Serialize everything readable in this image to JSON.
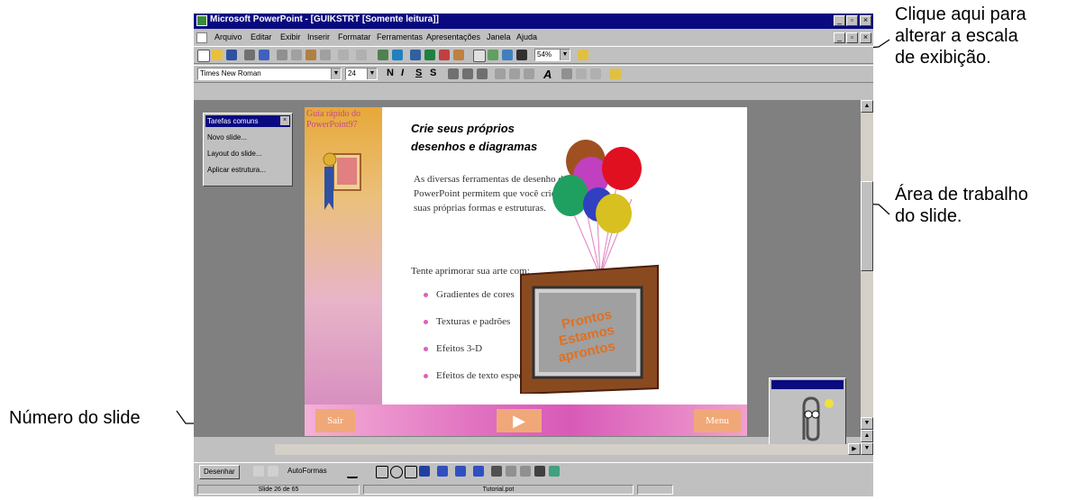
{
  "window": {
    "title": "Microsoft PowerPoint - [GUIKSTRT [Somente leitura]]",
    "menu": [
      "Arquivo",
      "Editar",
      "Exibir",
      "Inserir",
      "Formatar",
      "Ferramentas",
      "Apresentações",
      "Janela",
      "Ajuda"
    ],
    "zoom": "54%",
    "font": "Times New Roman",
    "font_size": "24"
  },
  "common_tasks": {
    "title": "Tarefas comuns",
    "items": [
      "Novo slide...",
      "Layout do slide...",
      "Aplicar estrutura..."
    ]
  },
  "slide": {
    "guide_title": "Guia rápido do PowerPoint97",
    "heading_line1": "Crie seus próprios",
    "heading_line2": "desenhos e diagramas",
    "body": "As diversas ferramentas de desenho do PowerPoint permitem que você crie facilmente suas próprias formas e estruturas.",
    "lead": "Tente aprimorar sua arte com:",
    "bullets": [
      "Gradientes de cores",
      "Texturas e padrões",
      "Efeitos 3-D",
      "Efeitos de texto especiais"
    ],
    "tv_text": "Prontos Estamos aprontos",
    "nav": {
      "exit": "Sair",
      "play": "▶",
      "menu": "Menu"
    }
  },
  "drawing_toolbar": {
    "draw": "Desenhar",
    "autoshapes": "AutoFormas"
  },
  "status": {
    "slide_number": "Slide 26 de 65",
    "file": "Tutorial.pot"
  },
  "callouts": {
    "zoom": [
      "Clique aqui para",
      "alterar a escala",
      "de exibição."
    ],
    "work_area": [
      "Área de trabalho",
      "do slide."
    ],
    "slide_number": "Número do slide"
  }
}
